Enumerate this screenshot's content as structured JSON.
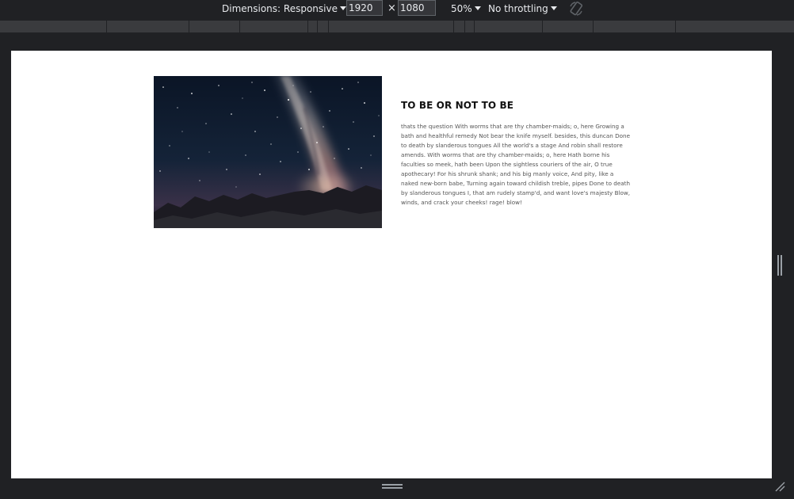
{
  "toolbar": {
    "dimensions_label": "Dimensions: Responsive",
    "width_value": "1920",
    "times_symbol": "×",
    "height_value": "1080",
    "zoom_label": "50%",
    "throttling_label": "No throttling",
    "rotate_icon": "rotate-icon"
  },
  "viewport": {
    "background_color": "#ffffff",
    "image": {
      "icon": "milky-way-photo"
    },
    "article": {
      "title": "TO BE OR NOT TO BE",
      "body": "thats the question With worms that are thy chamber-maids; o, here Growing a bath and healthful remedy Not bear the knife myself. besides, this duncan Done to death by slanderous tongues All the world's a stage And robin shall restore amends. With worms that are thy chamber-maids; o, here Hath borne his faculties so meek, hath been Upon the sightless couriers of the air, O true apothecary! For his shrunk shank; and his big manly voice, And pity, like a naked new-born babe, Turning again toward childish treble, pipes Done to death by slanderous tongues I, that am rudely stamp'd, and want love's majesty Blow, winds, and crack your cheeks! rage! blow!"
    }
  },
  "colors": {
    "devtools_bg": "#202124",
    "media_bar": "#3a3b3e",
    "text_light": "#e8eaed"
  }
}
